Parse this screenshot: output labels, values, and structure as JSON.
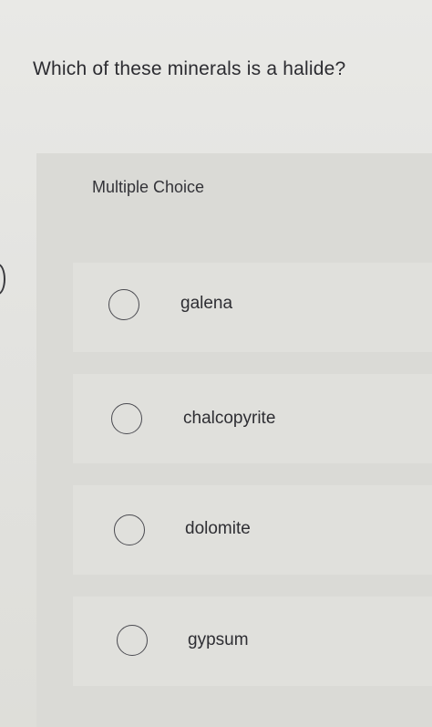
{
  "question": {
    "text": "Which of these minerals is a halide?"
  },
  "multiple_choice": {
    "title": "Multiple Choice",
    "options": [
      {
        "label": "galena"
      },
      {
        "label": "chalcopyrite"
      },
      {
        "label": "dolomite"
      },
      {
        "label": "gypsum"
      }
    ]
  }
}
